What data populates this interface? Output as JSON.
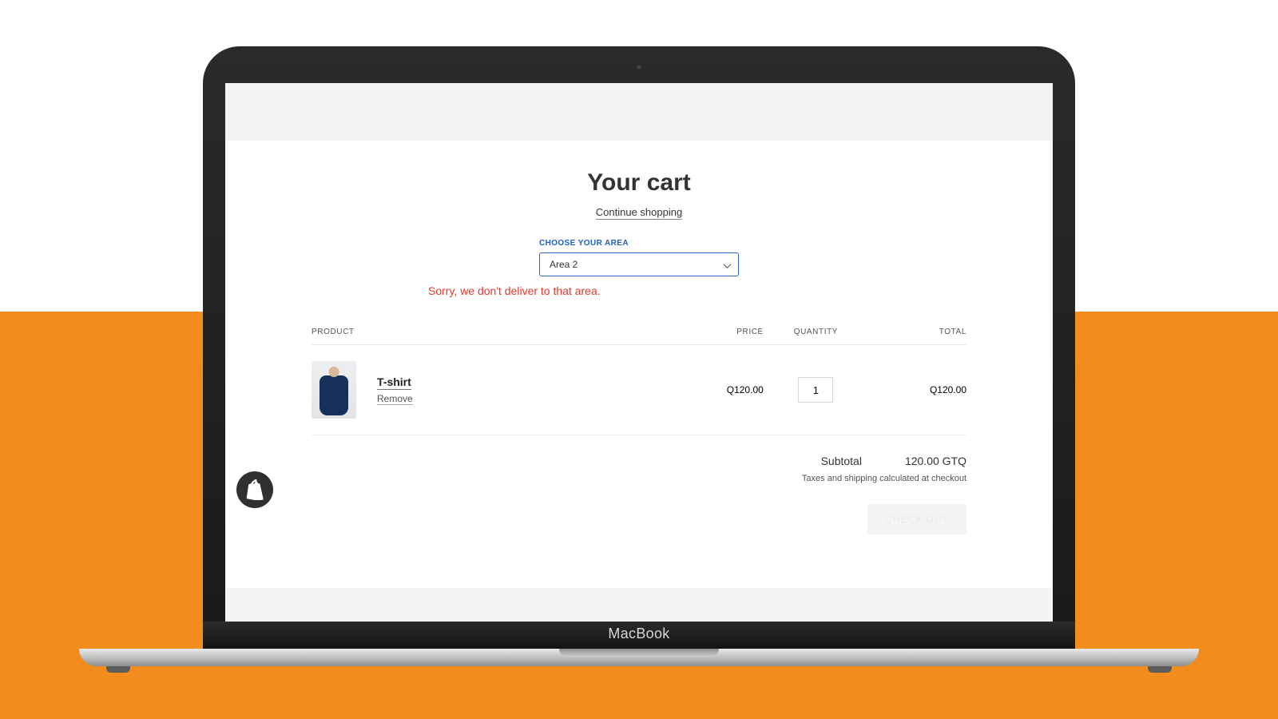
{
  "device": {
    "brand_label": "MacBook"
  },
  "page": {
    "title": "Your cart",
    "continue_label": "Continue shopping"
  },
  "area": {
    "label": "CHOOSE YOUR AREA",
    "selected": "Area 2",
    "error": "Sorry, we don't deliver to that area."
  },
  "table": {
    "headers": {
      "product": "PRODUCT",
      "price": "PRICE",
      "quantity": "QUANTITY",
      "total": "TOTAL"
    },
    "row": {
      "name": "T-shirt",
      "remove_label": "Remove",
      "price": "Q120.00",
      "quantity": "1",
      "total": "Q120.00"
    }
  },
  "summary": {
    "subtotal_label": "Subtotal",
    "subtotal_value": "120.00 GTQ",
    "note": "Taxes and shipping calculated at checkout",
    "checkout_label": "CHECK OUT"
  }
}
